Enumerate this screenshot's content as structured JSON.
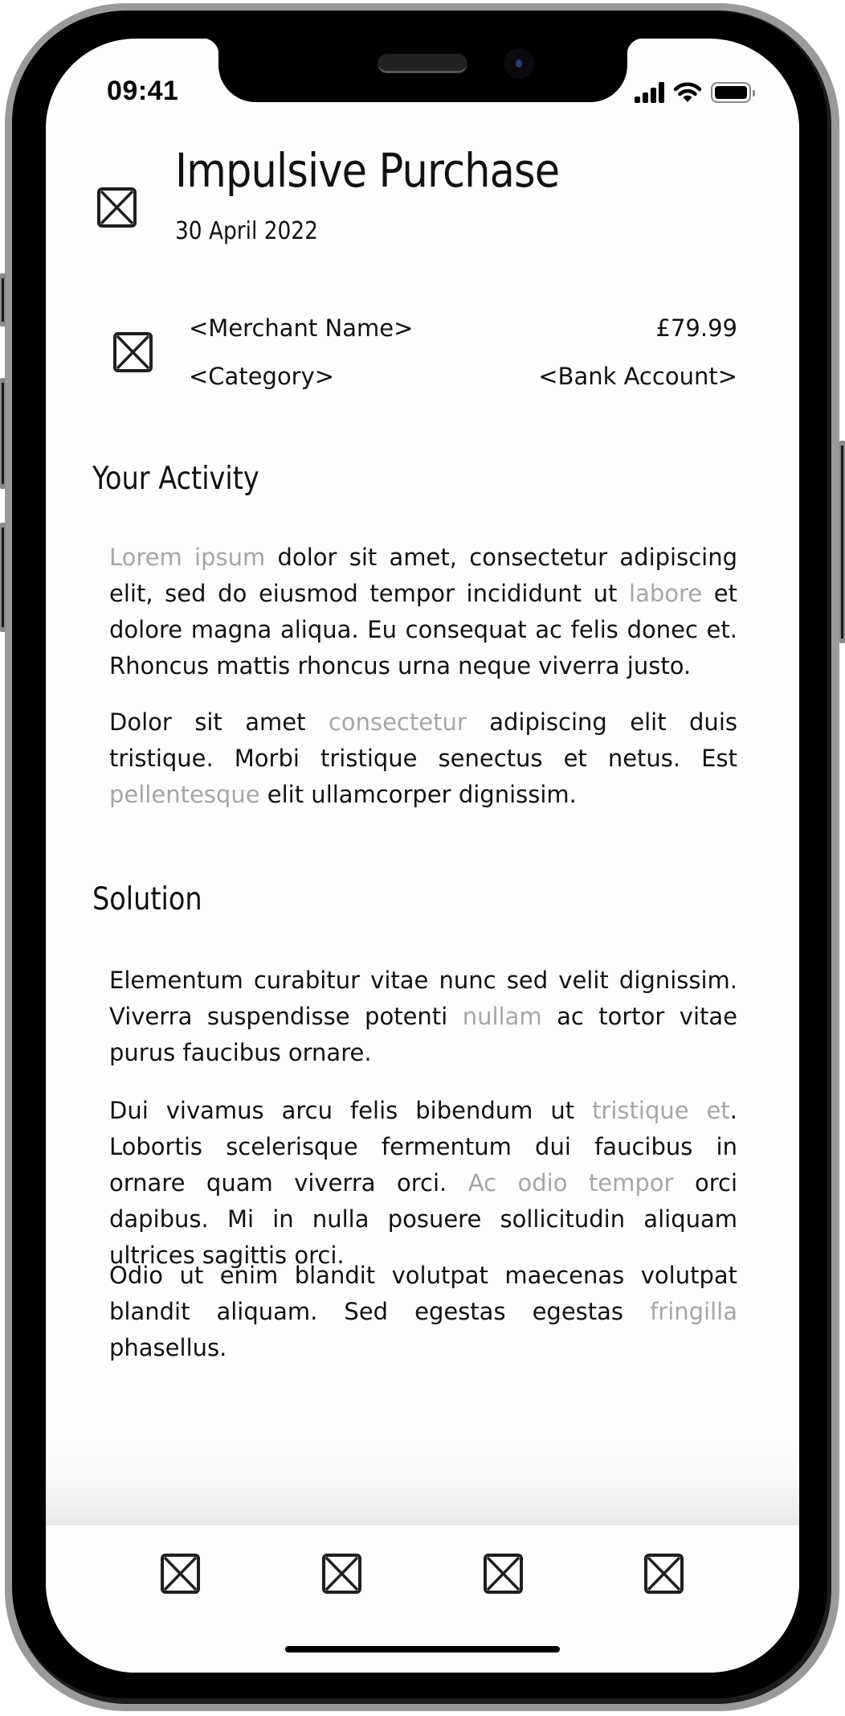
{
  "status_bar": {
    "time": "09:41",
    "icons": [
      "cellular-signal-icon",
      "wifi-icon",
      "battery-icon"
    ]
  },
  "header": {
    "icon": "image-placeholder-icon",
    "title": "Impulsive Purchase",
    "date": "30 April 2022"
  },
  "transaction": {
    "icon": "image-placeholder-icon",
    "merchant": "<Merchant Name>",
    "amount": "£79.99",
    "category": "<Category>",
    "bank_account": "<Bank Account>"
  },
  "sections": {
    "activity": {
      "heading": "Your Activity",
      "paragraphs": [
        {
          "segments": [
            {
              "text": "Lorem ipsum",
              "muted": true
            },
            {
              "text": " dolor sit amet, consectetur adipiscing elit, sed do eiusmod tempor incididunt ut ",
              "muted": false
            },
            {
              "text": "labore",
              "muted": true
            },
            {
              "text": " et dolore magna aliqua. Eu consequat ac felis donec et. Rhoncus mattis rhoncus urna neque viverra justo.",
              "muted": false
            }
          ]
        },
        {
          "segments": [
            {
              "text": "Dolor sit amet ",
              "muted": false
            },
            {
              "text": "consectetur",
              "muted": true
            },
            {
              "text": " adipiscing elit duis tristique. Morbi tristique senectus et netus. Est ",
              "muted": false
            },
            {
              "text": "pellentesque",
              "muted": true
            },
            {
              "text": " elit ullamcorper dignissim.",
              "muted": false
            }
          ]
        }
      ]
    },
    "solution": {
      "heading": "Solution",
      "paragraphs": [
        {
          "segments": [
            {
              "text": "Elementum curabitur vitae nunc sed velit dignissim. Viverra suspendisse potenti ",
              "muted": false
            },
            {
              "text": "nullam",
              "muted": true
            },
            {
              "text": " ac tortor vitae purus faucibus ornare.",
              "muted": false
            }
          ]
        },
        {
          "segments": [
            {
              "text": "Dui vivamus arcu felis bibendum ut ",
              "muted": false
            },
            {
              "text": "tristique et",
              "muted": true
            },
            {
              "text": ". Lobortis scelerisque fermentum dui faucibus in ornare quam viverra orci. ",
              "muted": false
            },
            {
              "text": "Ac odio tempor",
              "muted": true
            },
            {
              "text": " orci dapibus. Mi in nulla posuere sollicitudin aliquam ultrices sagittis orci.",
              "muted": false
            }
          ]
        },
        {
          "segments": [
            {
              "text": "Odio ut enim blandit volutpat maecenas volutpat blandit aliquam. Sed egestas egestas ",
              "muted": false
            },
            {
              "text": "fringilla",
              "muted": true
            },
            {
              "text": " phasellus.",
              "muted": false
            }
          ]
        }
      ]
    }
  },
  "tab_bar": {
    "items": [
      {
        "icon": "image-placeholder-icon"
      },
      {
        "icon": "image-placeholder-icon"
      },
      {
        "icon": "image-placeholder-icon"
      },
      {
        "icon": "image-placeholder-icon"
      }
    ]
  },
  "colors": {
    "text": "#111111",
    "muted_text": "#a6a6a6",
    "screen_bg": "#fdfdfd"
  }
}
